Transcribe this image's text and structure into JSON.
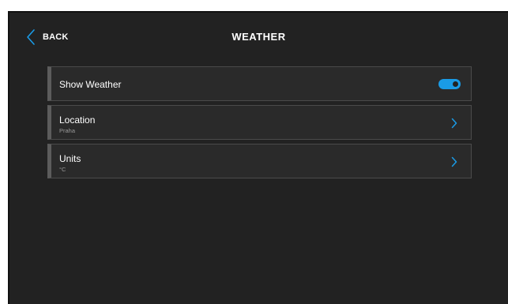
{
  "header": {
    "back_label": "BACK",
    "title": "WEATHER"
  },
  "settings": {
    "rows": [
      {
        "label": "Show Weather",
        "toggle_on": true
      },
      {
        "label": "Location",
        "value": "Praha"
      },
      {
        "label": "Units",
        "value": "°C"
      }
    ]
  },
  "colors": {
    "accent": "#1a9be6",
    "background": "#222222",
    "row_background": "#2a2a2a",
    "row_border": "#4a4a4a",
    "row_edge": "#5c5c5c",
    "subtext": "#9a9a9a"
  },
  "icons": {
    "back": "chevron-left-icon",
    "row_arrow": "chevron-right-icon",
    "toggle": "toggle-switch-icon"
  }
}
